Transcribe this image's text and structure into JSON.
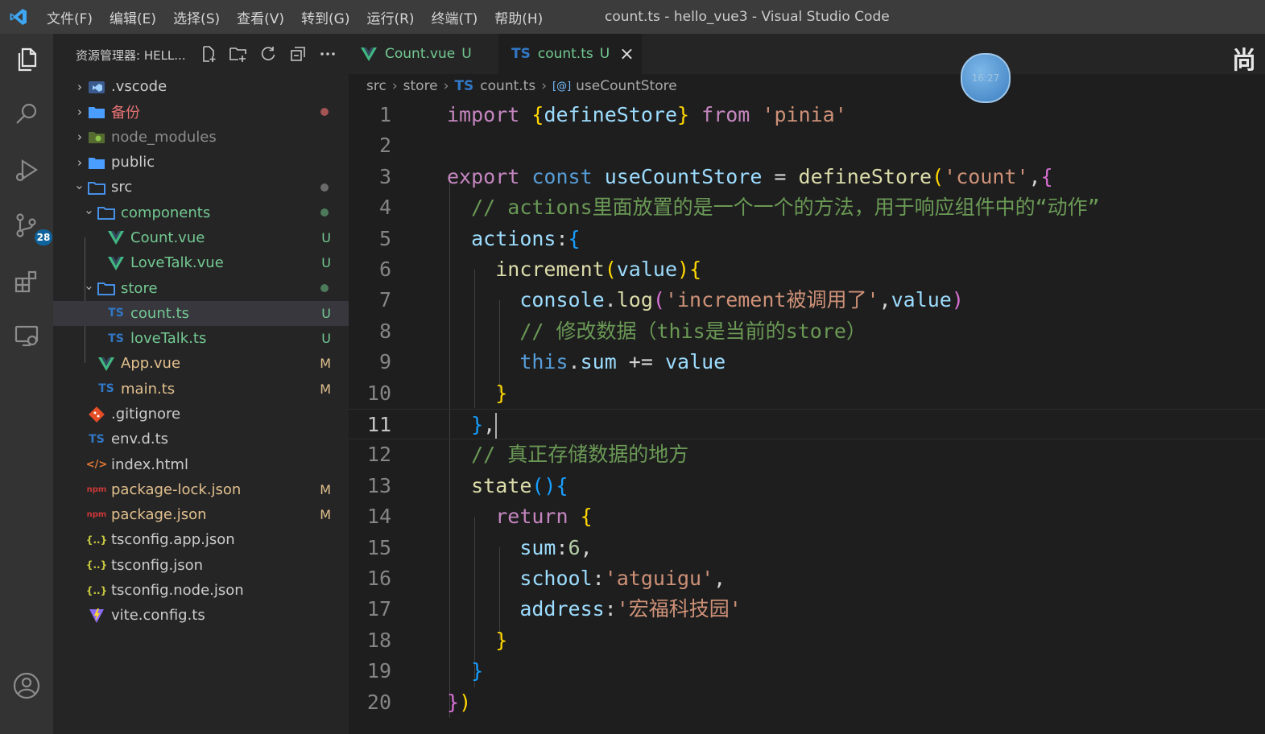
{
  "window": {
    "title": "count.ts - hello_vue3 - Visual Studio Code",
    "menu": [
      "文件(F)",
      "编辑(E)",
      "选择(S)",
      "查看(V)",
      "转到(G)",
      "运行(R)",
      "终端(T)",
      "帮助(H)"
    ]
  },
  "activity_bar": {
    "items": [
      "explorer-icon",
      "search-icon",
      "run-debug-icon",
      "source-control-icon",
      "extensions-icon",
      "remote-explorer-icon",
      "account-icon"
    ],
    "source_control_badge": "28"
  },
  "explorer": {
    "title": "资源管理器: HELL...",
    "actions": [
      "new-file-icon",
      "new-folder-icon",
      "refresh-icon",
      "collapse-all-icon",
      "more-icon"
    ],
    "items": [
      {
        "label": ".vscode",
        "status": ""
      },
      {
        "label": "备份",
        "status": ""
      },
      {
        "label": "node_modules",
        "status": ""
      },
      {
        "label": "public",
        "status": ""
      },
      {
        "label": "src",
        "status": ""
      },
      {
        "label": "components",
        "status": ""
      },
      {
        "label": "Count.vue",
        "status": "U"
      },
      {
        "label": "LoveTalk.vue",
        "status": "U"
      },
      {
        "label": "store",
        "status": ""
      },
      {
        "label": "count.ts",
        "status": "U"
      },
      {
        "label": "loveTalk.ts",
        "status": "U"
      },
      {
        "label": "App.vue",
        "status": "M"
      },
      {
        "label": "main.ts",
        "status": "M"
      },
      {
        "label": ".gitignore",
        "status": ""
      },
      {
        "label": "env.d.ts",
        "status": ""
      },
      {
        "label": "index.html",
        "status": ""
      },
      {
        "label": "package-lock.json",
        "status": "M"
      },
      {
        "label": "package.json",
        "status": "M"
      },
      {
        "label": "tsconfig.app.json",
        "status": ""
      },
      {
        "label": "tsconfig.json",
        "status": ""
      },
      {
        "label": "tsconfig.node.json",
        "status": ""
      },
      {
        "label": "vite.config.ts",
        "status": ""
      }
    ],
    "icon_text": {
      "ts": "TS",
      "json": "{..}",
      "html": "</>",
      "npm": "npm"
    }
  },
  "tabs": [
    {
      "label": "Count.vue",
      "status": "U",
      "active": false
    },
    {
      "label": "count.ts",
      "status": "U",
      "active": true
    }
  ],
  "tab_close": "×",
  "breadcrumb": {
    "items": [
      "src",
      "store",
      "count.ts",
      "useCountStore"
    ],
    "ts_icon": "TS"
  },
  "editor": {
    "line_numbers": [
      "1",
      "2",
      "3",
      "4",
      "5",
      "6",
      "7",
      "8",
      "9",
      "10",
      "11",
      "12",
      "13",
      "14",
      "15",
      "16",
      "17",
      "18",
      "19",
      "20"
    ],
    "current_line": "11",
    "lines": [
      [
        [
          "kw",
          "import"
        ],
        [
          "p",
          " "
        ],
        [
          "b1",
          "{"
        ],
        [
          "var",
          "defineStore"
        ],
        [
          "b1",
          "}"
        ],
        [
          "p",
          " "
        ],
        [
          "kw",
          "from"
        ],
        [
          "p",
          " "
        ],
        [
          "str",
          "'pinia'"
        ]
      ],
      [],
      [
        [
          "kw",
          "export"
        ],
        [
          "p",
          " "
        ],
        [
          "kwb",
          "const"
        ],
        [
          "p",
          " "
        ],
        [
          "var",
          "useCountStore"
        ],
        [
          "p",
          " = "
        ],
        [
          "fn",
          "defineStore"
        ],
        [
          "b1",
          "("
        ],
        [
          "str",
          "'count'"
        ],
        [
          "p",
          ","
        ],
        [
          "b2",
          "{"
        ]
      ],
      [
        [
          "p",
          "  "
        ],
        [
          "cm",
          "// actions里面放置的是一个一个的方法，用于响应组件中的“动作”"
        ]
      ],
      [
        [
          "p",
          "  "
        ],
        [
          "var",
          "actions"
        ],
        [
          "p",
          ":"
        ],
        [
          "b3",
          "{"
        ]
      ],
      [
        [
          "p",
          "    "
        ],
        [
          "fn",
          "increment"
        ],
        [
          "b1",
          "("
        ],
        [
          "var",
          "value"
        ],
        [
          "b1",
          ")"
        ],
        [
          "b1",
          "{"
        ]
      ],
      [
        [
          "p",
          "      "
        ],
        [
          "var",
          "console"
        ],
        [
          "p",
          "."
        ],
        [
          "fn",
          "log"
        ],
        [
          "b2",
          "("
        ],
        [
          "str",
          "'increment被调用了'"
        ],
        [
          "p",
          ","
        ],
        [
          "var",
          "value"
        ],
        [
          "b2",
          ")"
        ]
      ],
      [
        [
          "p",
          "      "
        ],
        [
          "cm",
          "// 修改数据（this是当前的store）"
        ]
      ],
      [
        [
          "p",
          "      "
        ],
        [
          "kwb",
          "this"
        ],
        [
          "p",
          "."
        ],
        [
          "var",
          "sum"
        ],
        [
          "p",
          " += "
        ],
        [
          "var",
          "value"
        ]
      ],
      [
        [
          "p",
          "    "
        ],
        [
          "b1",
          "}"
        ]
      ],
      [
        [
          "p",
          "  "
        ],
        [
          "b3",
          "}"
        ],
        [
          "p",
          ","
        ]
      ],
      [
        [
          "p",
          "  "
        ],
        [
          "cm",
          "// 真正存储数据的地方"
        ]
      ],
      [
        [
          "p",
          "  "
        ],
        [
          "fn",
          "state"
        ],
        [
          "b3",
          "()"
        ],
        [
          "b3",
          "{"
        ]
      ],
      [
        [
          "p",
          "    "
        ],
        [
          "kw",
          "return"
        ],
        [
          "p",
          " "
        ],
        [
          "b1",
          "{"
        ]
      ],
      [
        [
          "p",
          "      "
        ],
        [
          "var",
          "sum"
        ],
        [
          "p",
          ":"
        ],
        [
          "num",
          "6"
        ],
        [
          "p",
          ","
        ]
      ],
      [
        [
          "p",
          "      "
        ],
        [
          "var",
          "school"
        ],
        [
          "p",
          ":"
        ],
        [
          "str",
          "'atguigu'"
        ],
        [
          "p",
          ","
        ]
      ],
      [
        [
          "p",
          "      "
        ],
        [
          "var",
          "address"
        ],
        [
          "p",
          ":"
        ],
        [
          "str",
          "'宏福科技园'"
        ]
      ],
      [
        [
          "p",
          "    "
        ],
        [
          "b1",
          "}"
        ]
      ],
      [
        [
          "p",
          "  "
        ],
        [
          "b3",
          "}"
        ]
      ],
      [
        [
          "b2",
          "}"
        ],
        [
          "b1",
          ")"
        ]
      ]
    ]
  },
  "overlay": {
    "clock_text": "16:27",
    "corner_text": "尚"
  },
  "colors": {
    "vue": "#41b883",
    "ts": "#3178c6",
    "folder": "#4a9eff",
    "untracked": "#73c991",
    "modified": "#e2c08d",
    "accent": "#0e639c",
    "ignored": "#8c8c8c",
    "backup_text": "#e57373"
  }
}
